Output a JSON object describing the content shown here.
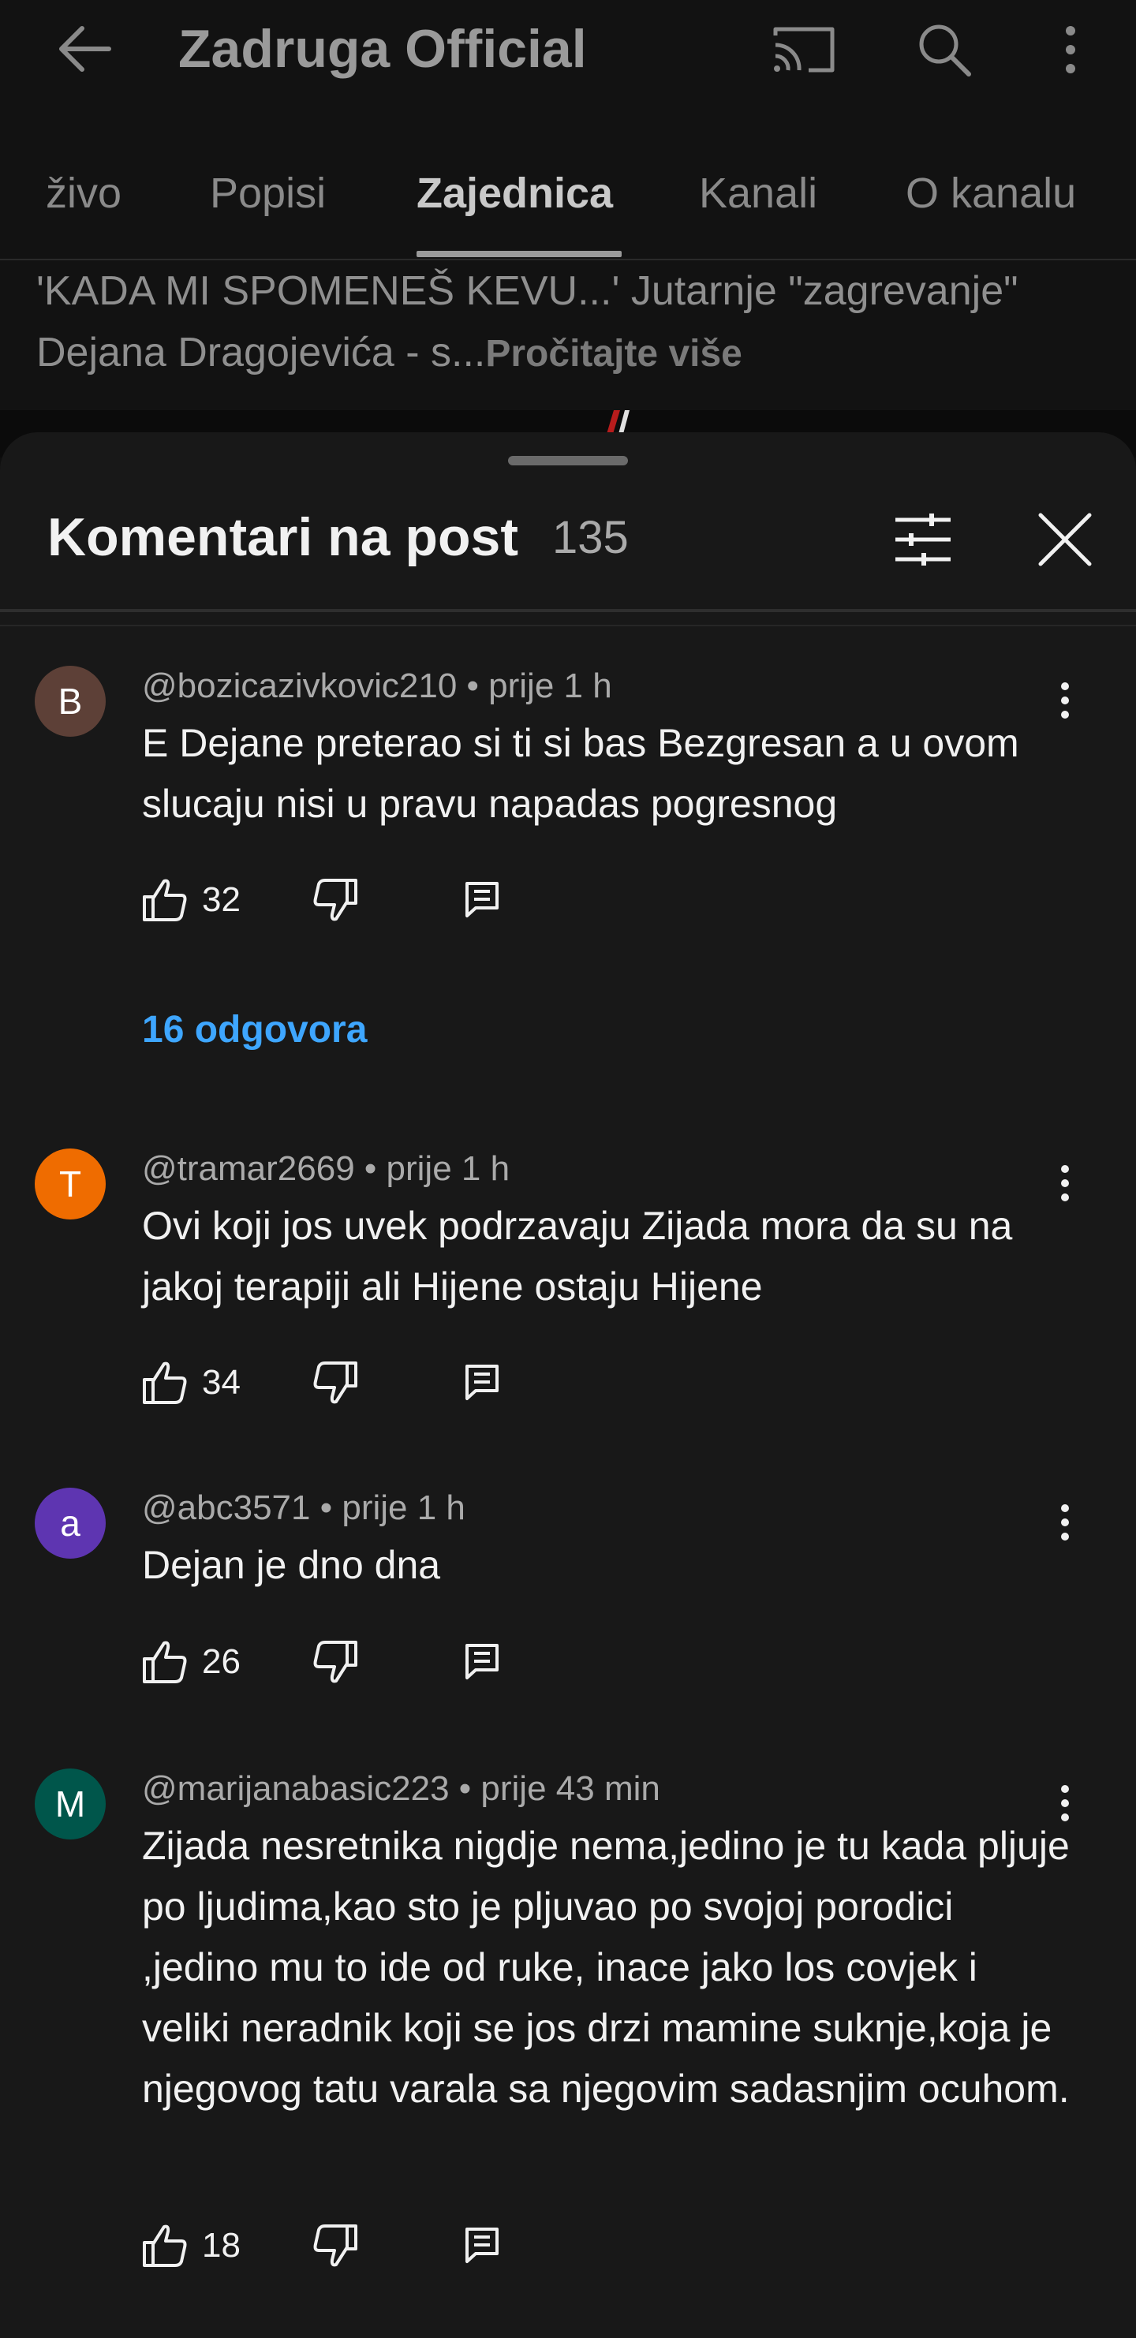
{
  "header": {
    "channel_title": "Zadruga Official",
    "icons": {
      "back": "arrow-back-icon",
      "cast": "cast-icon",
      "search": "search-icon",
      "more": "more-vert-icon"
    }
  },
  "tabs": [
    {
      "label": "živo",
      "active": false
    },
    {
      "label": "Popisi",
      "active": false
    },
    {
      "label": "Zajednica",
      "active": true
    },
    {
      "label": "Kanali",
      "active": false
    },
    {
      "label": "O kanalu",
      "active": false
    }
  ],
  "post": {
    "text": "'KADA MI SPOMENEŠ KEVU...' Jutarnje \"zagrevanje\" Dejana Dragojevića - s...",
    "read_more": "Pročitajte više"
  },
  "comments_sheet": {
    "title": "Komentari na post",
    "count": "135",
    "icons": {
      "filter": "tune-icon",
      "close": "close-icon"
    }
  },
  "comments": [
    {
      "avatar_letter": "B",
      "avatar_color": "#5d4037",
      "author": "@bozicazivkovic210",
      "time": "prije 1 h",
      "text": "E Dejane preterao si ti si bas Bezgresan a u ovom slucaju nisi u pravu napadas pogresnog",
      "likes": "32",
      "replies_label": "16 odgovora"
    },
    {
      "avatar_letter": "T",
      "avatar_color": "#ef6c00",
      "author": "@tramar2669",
      "time": "prije 1 h",
      "text": "Ovi koji jos uvek podrzavaju Zijada mora da su na jakoj terapiji ali Hijene ostaju Hijene",
      "likes": "34"
    },
    {
      "avatar_letter": "a",
      "avatar_color": "#5e35b1",
      "author": "@abc3571",
      "time": "prije 1 h",
      "text": "Dejan je dno dna",
      "likes": "26"
    },
    {
      "avatar_letter": "M",
      "avatar_color": "#00564b",
      "author": "@marijanabasic223",
      "time": "prije 43 min",
      "text": "Zijada nesretnika nigdje nema,jedino je tu kada pljuje po ljudima,kao sto je pljuvao po svojoj porodici ,jedino mu to ide od ruke, inace jako los covjek i veliki neradnik koji se jos drzi mamine suknje,koja je njegovog tatu varala sa njegovim sadasnjim ocuhom.",
      "likes": "18"
    }
  ],
  "colors": {
    "background": "#0f0f0f",
    "sheet": "#181818",
    "link": "#3ea6ff"
  }
}
